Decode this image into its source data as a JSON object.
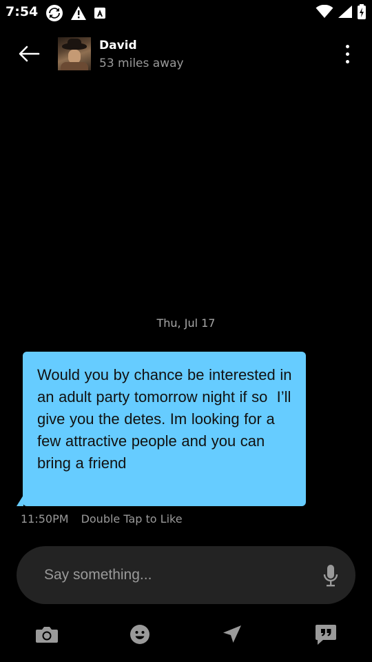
{
  "status_bar": {
    "time": "7:54",
    "left_icons": [
      "sync-icon",
      "warning-icon",
      "font-box-icon"
    ],
    "right_icons": [
      "wifi-icon",
      "signal-icon",
      "battery-charging-icon"
    ]
  },
  "header": {
    "contact_name": "David",
    "distance": "53 miles away",
    "icons": {
      "back": "arrow-left-icon",
      "more": "more-vertical-icon"
    }
  },
  "conversation": {
    "date_label": "Thu, Jul 17",
    "messages": [
      {
        "text": "Would you by chance be interested in an adult party tomorrow night if so  I’ll give you the detes. Im looking for a few attractive people and you can bring a friend",
        "time": "11:50PM",
        "action_hint": "Double Tap to Like"
      }
    ]
  },
  "composer": {
    "placeholder": "Say something...",
    "value": ""
  },
  "toolbar": {
    "icons": [
      "camera-icon",
      "emoji-icon",
      "location-icon",
      "quick-replies-icon"
    ]
  },
  "colors": {
    "background": "#000000",
    "bubble": "#66ccff",
    "composer": "#232323",
    "icon_gray": "#9a9a9a"
  }
}
